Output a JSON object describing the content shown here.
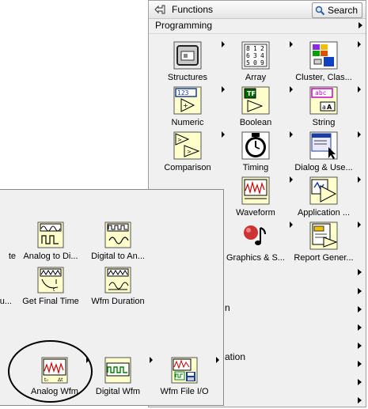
{
  "palette": {
    "title": "Functions",
    "search_label": "Search",
    "category": "Programming",
    "items": [
      {
        "label": "Structures"
      },
      {
        "label": "Array"
      },
      {
        "label": "Cluster, Clas..."
      },
      {
        "label": "Numeric",
        "icon_text": "123"
      },
      {
        "label": "Boolean",
        "icon_text": "TF"
      },
      {
        "label": "String",
        "icon_text": "abc"
      },
      {
        "label": "Comparison"
      },
      {
        "label": "Timing"
      },
      {
        "label": "Dialog & Use..."
      },
      {
        "label": "Waveform"
      },
      {
        "label": "Application ..."
      },
      {
        "label": "Graphics & S..."
      },
      {
        "label": "Report Gener..."
      }
    ],
    "partial_rows": [
      "n",
      "ation"
    ],
    "array_icon_cells": [
      "8",
      "1",
      "2",
      "6",
      "3",
      "4",
      "5",
      "0",
      "9"
    ]
  },
  "waveform_palette": {
    "items": [
      {
        "label": "te"
      },
      {
        "label": "Analog to Di..."
      },
      {
        "label": "Digital to An..."
      },
      {
        "label": "u..."
      },
      {
        "label": "Get Final Time"
      },
      {
        "label": "Wfm Duration"
      },
      {
        "label": "Analog Wfm"
      },
      {
        "label": "Digital Wfm"
      },
      {
        "label": "Wfm File I/O"
      }
    ]
  },
  "colors": {
    "palette_bg": "#f0f0f0",
    "icon_yellow": "#ffffcc",
    "icon_green": "#008000",
    "icon_purple": "#cc00cc",
    "icon_blue": "#0000a0"
  }
}
